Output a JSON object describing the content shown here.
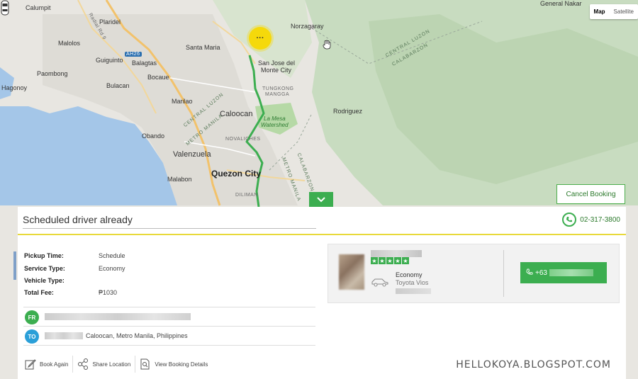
{
  "map": {
    "type_buttons": [
      {
        "label": "Map",
        "active": true
      },
      {
        "label": "Satellite",
        "active": false
      }
    ],
    "labels": {
      "calumpit": "Calumpit",
      "plaridel": "Plaridel",
      "malolos": "Malolos",
      "guiguinto": "Guiguinto",
      "paombong": "Paombong",
      "hagonoy": "Hagonoy",
      "santa_maria": "Santa Maria",
      "balagtas": "Balagtas",
      "bocaue": "Bocaue",
      "bulacan": "Bulacan",
      "marilao": "Marilao",
      "norzagaray": "Norzagaray",
      "san_jose": "San Jose del",
      "monte_city": "Monte City",
      "tungkong": "TUNGKONG",
      "mangga": "MANGGA",
      "caloocan": "Caloocan",
      "obando": "Obando",
      "la_mesa": "La Mesa",
      "watershed": "Watershed",
      "rodriguez": "Rodriguez",
      "novaliches": "NOVALICHES",
      "valenzuela": "Valenzuela",
      "quezon_city": "Quezon City",
      "malabon": "Malabon",
      "diliman": "DILIMAN",
      "general_nakar": "General Nakar",
      "central_luzon": "CENTRAL LUZON",
      "calabarzon": "CALABARZON",
      "road_ah26": "AH26",
      "radial_rd": "Radial Rd 9",
      "metro_manila": "METRO MANILA",
      "central_luzon_2": "CENTRAL LUZON",
      "metro_manila_2": "METRO MANILA",
      "calabarzon_2": "CALABARZON"
    },
    "marker_symbol": "···"
  },
  "booking": {
    "cancel_label": "Cancel Booking",
    "status_title": "Scheduled driver already",
    "hotline": "02-317-3800",
    "details": [
      {
        "label": "Pickup Time:",
        "value": "Schedule"
      },
      {
        "label": "Service Type:",
        "value": "Economy"
      },
      {
        "label": "Vehicle Type:",
        "value": ""
      },
      {
        "label": "Total Fee:",
        "value": "₱1030"
      }
    ],
    "from_badge": "FR",
    "to_badge": "TO",
    "to_address": "Caloocan, Metro Manila, Philippines",
    "actions": [
      {
        "label": "Book Again",
        "icon": "edit-icon"
      },
      {
        "label": "Share Location",
        "icon": "share-icon"
      },
      {
        "label": "View Booking Details",
        "icon": "document-search-icon"
      }
    ]
  },
  "driver": {
    "vehicle_class": "Economy",
    "vehicle_model": "Toyota Vios",
    "rating_stars": 5,
    "call_prefix": "+63"
  },
  "watermark": "HELLOKOYA.BLOGSPOT.COM",
  "colors": {
    "accent": "#3cae50",
    "marker": "#f5d90b",
    "divider": "#e8d93a"
  }
}
